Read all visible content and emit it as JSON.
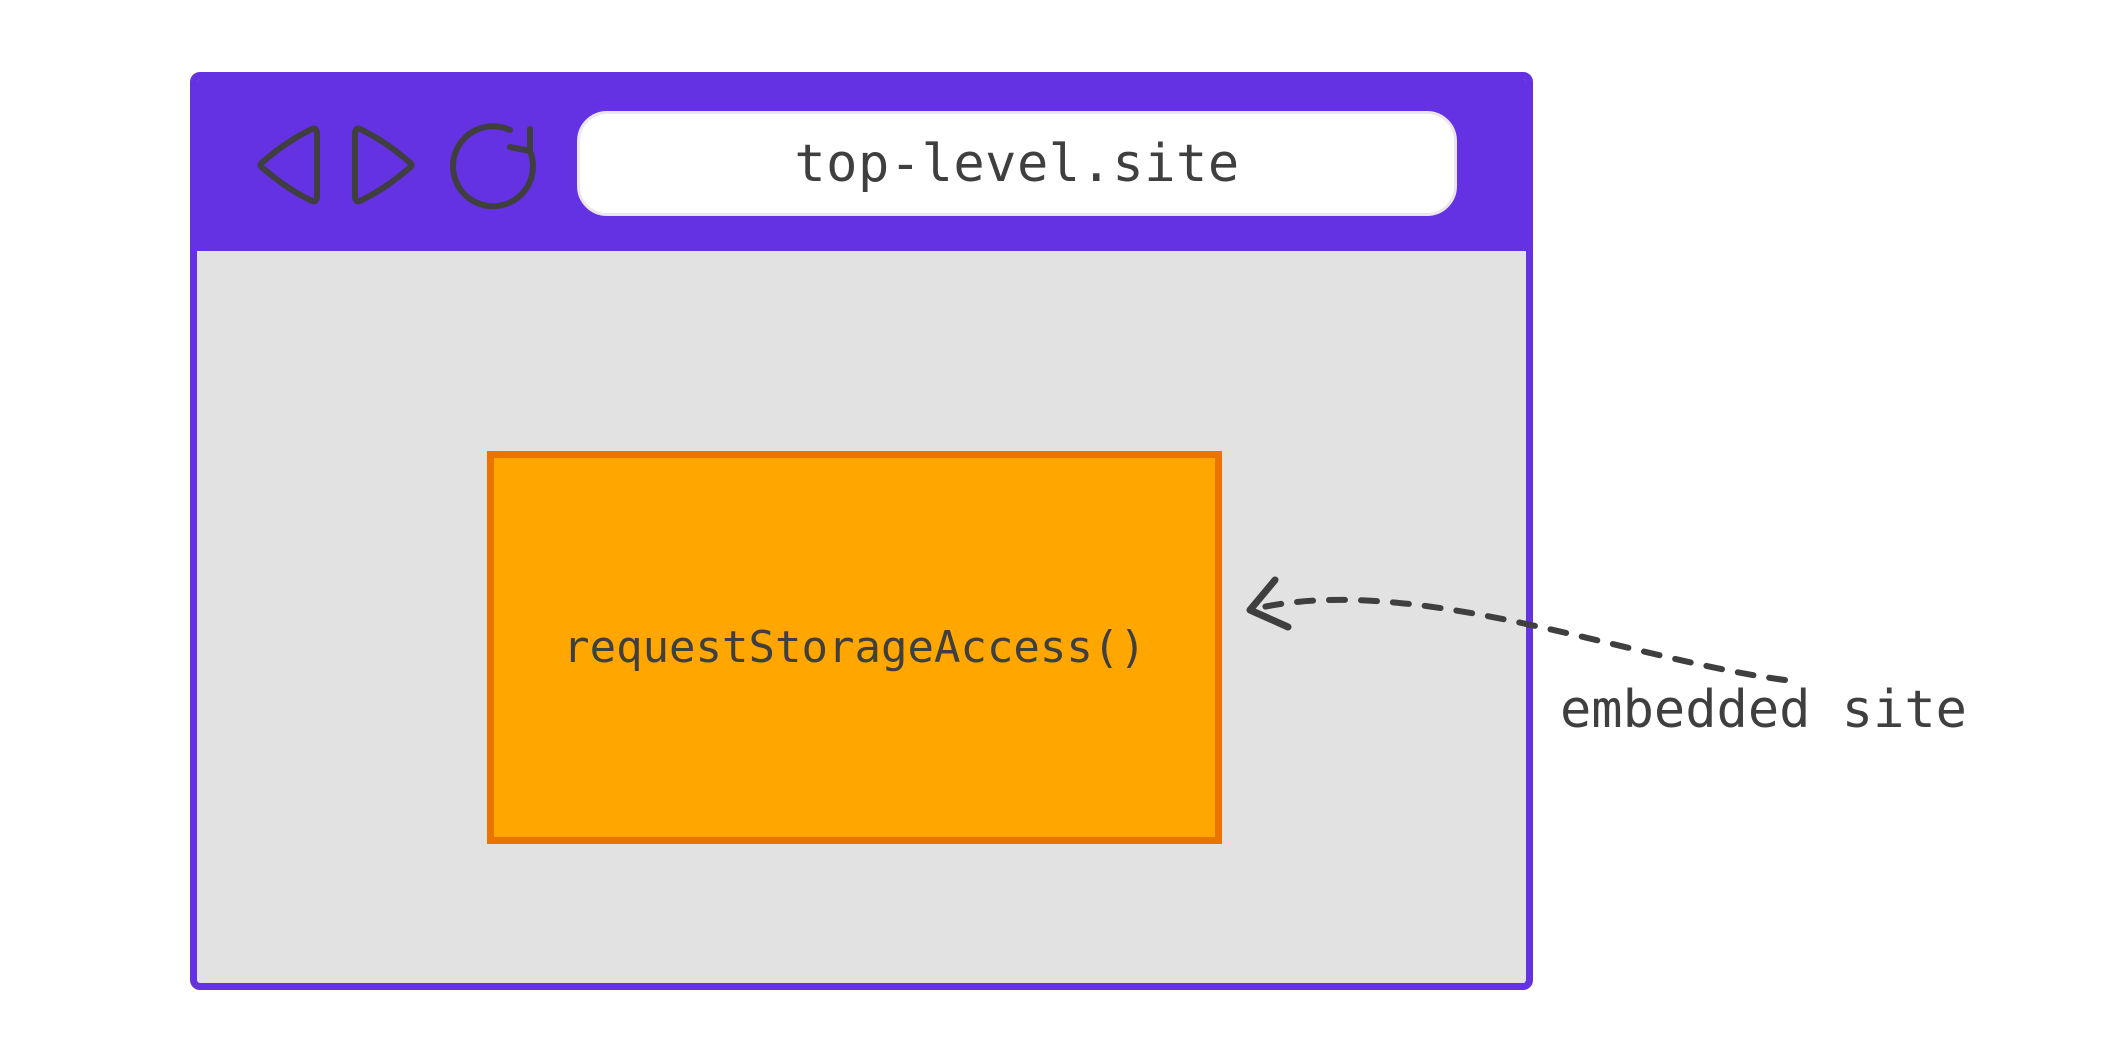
{
  "browser": {
    "address_bar": "top-level.site",
    "nav_icons": {
      "back_name": "back-icon",
      "forward_name": "forward-icon",
      "reload_name": "reload-icon"
    }
  },
  "embedded": {
    "box_label": "requestStorageAccess()",
    "annotation": "embedded site"
  },
  "colors": {
    "browser_purple": "#6432e2",
    "content_bg": "#e2e2e2",
    "embedded_fill": "#ffa700",
    "embedded_border": "#e97500",
    "text": "#3f3f3f"
  }
}
